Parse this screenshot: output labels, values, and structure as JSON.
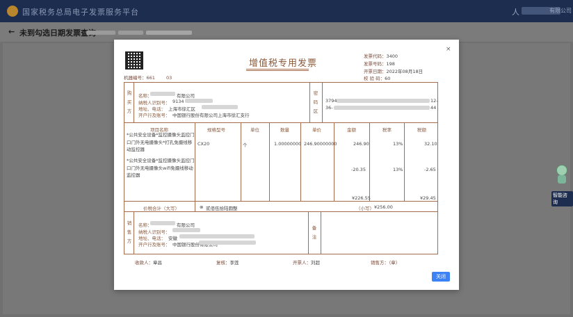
{
  "topbar": {
    "brand": "国家税务总局电子发票服务平台",
    "user_icon": "人",
    "user_suffix": "有限公司"
  },
  "header": {
    "back_icon": "←",
    "title": "未到勾选日期发票查询",
    "breadcrumb": [
      "",
      "",
      "未到勾选日期发票查询"
    ]
  },
  "modal": {
    "close_icon": "×",
    "invoice_title": "增值税专用发票",
    "machine_no_label": "机器编号：",
    "machine_no_value": "661",
    "machine_no_suffix": "03",
    "meta": [
      {
        "label": "发票代码：",
        "value": "3400"
      },
      {
        "label": "发票号码：",
        "value": "198"
      },
      {
        "label": "开票日期：",
        "value": "2022年08月18日"
      },
      {
        "label": "校  验  码：",
        "value": "60"
      }
    ],
    "buyer": {
      "section_label": "购买方",
      "name_label": "名称：",
      "name_suffix": "有限公司",
      "tax_label": "纳税人识别号：",
      "tax_value": "9134",
      "addr_label": "地址、电话：",
      "addr_value": "上海市徐汇区",
      "bank_label": "开户行及账号：",
      "bank_value": "中国银行股份有限公司上海市徐汇支行"
    },
    "password_label": "密码区",
    "password_lines": [
      "3794",
      "36-"
    ],
    "password_tail": [
      "12-",
      "44"
    ],
    "columns": [
      "项目名称",
      "规格型号",
      "单位",
      "数量",
      "单价",
      "金额",
      "税率",
      "税额"
    ],
    "items": [
      {
        "name": "*公共安全设备*监控摄像头监控门口门外无电摄像头*打孔免摄线移动监控器",
        "spec": "CX20",
        "unit": "个",
        "qty": "1.00000000",
        "price": "246.90000000",
        "amount": "246.90",
        "rate": "13%",
        "tax": "32.10"
      },
      {
        "name": "*公共安全设备*监控摄像头监控门口门外无电摄像头wifi免摄线移动监控器",
        "spec": "",
        "unit": "",
        "qty": "",
        "price": "",
        "amount": "-20.35",
        "rate": "13%",
        "tax": "-2.65"
      }
    ],
    "total_amount": "¥226.55",
    "total_tax": "¥29.45",
    "total_label": "价税合计（大写）",
    "total_words_icon": "⊗",
    "total_words": "贰佰伍拾陆圆整",
    "total_small_label": "（小写）",
    "total_small_value": "¥256.00",
    "seller": {
      "section_label": "销售方",
      "name_label": "名称：",
      "name_suffix": "有限公司",
      "tax_label": "纳税人识别号：",
      "addr_label": "地址、电话：",
      "addr_value": "安徽",
      "bank_label": "开户行及账号：",
      "bank_value": "中国银行股份有限公司"
    },
    "remark_label": "备注",
    "payee_label": "收款人：",
    "payee_value": "章昌",
    "reviewer_label": "复核：",
    "reviewer_value": "李莲",
    "drawer_label": "开票人：",
    "drawer_value": "刘超",
    "seller_seal_label": "销售方：（章）",
    "close_button": "关闭"
  },
  "assistant": {
    "label": "智能咨询"
  }
}
